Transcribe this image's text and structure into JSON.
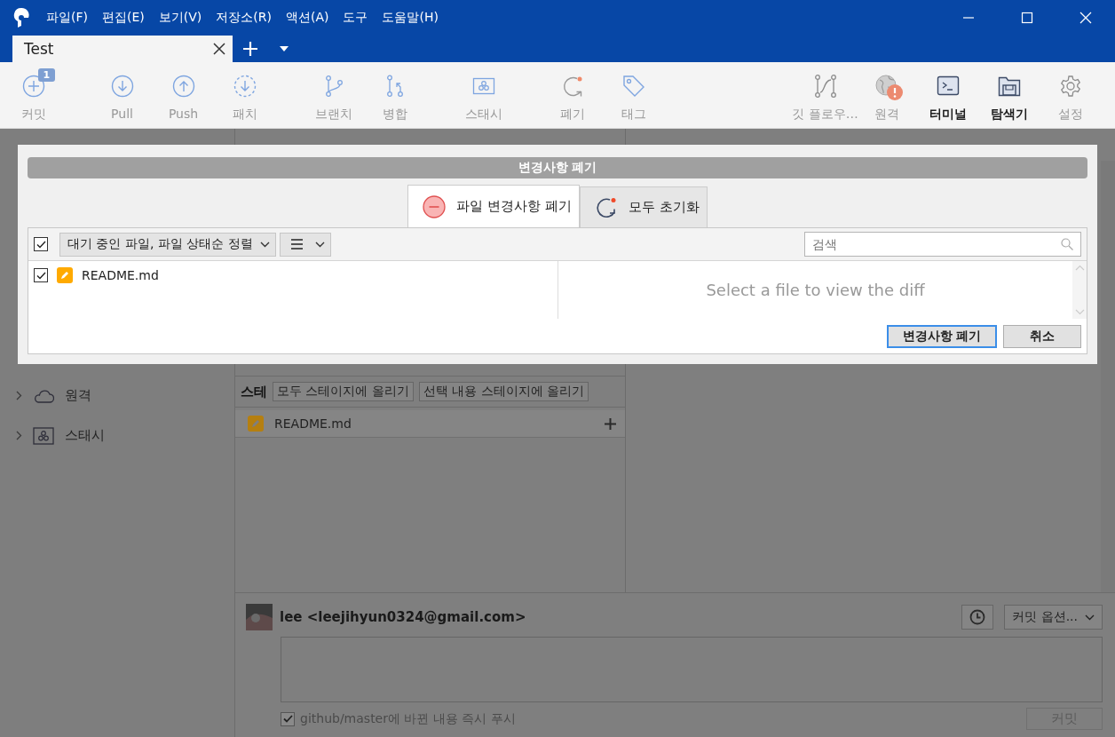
{
  "window": {
    "menu": [
      "파일(F)",
      "편집(E)",
      "보기(V)",
      "저장소(R)",
      "액션(A)",
      "도구",
      "도움말(H)"
    ]
  },
  "tabs": [
    {
      "label": "Test",
      "selected": true
    }
  ],
  "toolbar": [
    {
      "label": "커밋",
      "kind": "commit",
      "badge": "1",
      "disabled": true
    },
    {
      "label": "Pull",
      "kind": "pull",
      "disabled": true
    },
    {
      "label": "Push",
      "kind": "push",
      "disabled": true
    },
    {
      "label": "패치",
      "kind": "patch",
      "disabled": true
    },
    {
      "label": "브랜치",
      "kind": "branch",
      "disabled": true
    },
    {
      "label": "병합",
      "kind": "merge",
      "disabled": true
    },
    {
      "label": "스태시",
      "kind": "stash",
      "disabled": true
    },
    {
      "label": "폐기",
      "kind": "discard",
      "disabled": true
    },
    {
      "label": "태그",
      "kind": "tag",
      "disabled": true
    },
    {
      "label": "깃 플로우…",
      "kind": "gitflow",
      "disabled": true
    },
    {
      "label": "원격",
      "kind": "remote",
      "disabled": true,
      "warning": true
    },
    {
      "label": "터미널",
      "kind": "terminal",
      "disabled": false
    },
    {
      "label": "탐색기",
      "kind": "explorer",
      "disabled": false
    },
    {
      "label": "설정",
      "kind": "settings",
      "disabled": true
    }
  ],
  "sidebar": {
    "items": [
      {
        "label": "원격",
        "kind": "cloud"
      },
      {
        "label": "스태시",
        "kind": "stash"
      }
    ]
  },
  "staging": {
    "label": "스테",
    "buttons": [
      "모두 스테이지에 올리기",
      "선택 내용 스테이지에 올리기"
    ],
    "files": [
      {
        "name": "README.md"
      }
    ]
  },
  "commit": {
    "author": "lee <leejihyun0324@gmail.com>",
    "options": "커밋 옵션...",
    "push_now": {
      "label": "github/master에 바뀐 내용 즉시 푸시",
      "checked": true
    },
    "commit_button": "커밋"
  },
  "dialog": {
    "title": "변경사항 폐기",
    "tabs": [
      {
        "label": "파일 변경사항 폐기",
        "kind": "discard",
        "selected": true
      },
      {
        "label": "모두 초기화",
        "kind": "reset",
        "selected": false
      }
    ],
    "select_all": {
      "checked": true
    },
    "sort": "대기 중인 파일, 파일 상태순 정렬",
    "search": {
      "placeholder": "검색"
    },
    "files": [
      {
        "name": "README.md",
        "checked": true
      }
    ],
    "diff_placeholder": "Select a file to view the diff",
    "buttons": [
      {
        "label": "변경사항 폐기",
        "kind": "primary"
      },
      {
        "label": "취소",
        "kind": "secondary"
      }
    ]
  }
}
